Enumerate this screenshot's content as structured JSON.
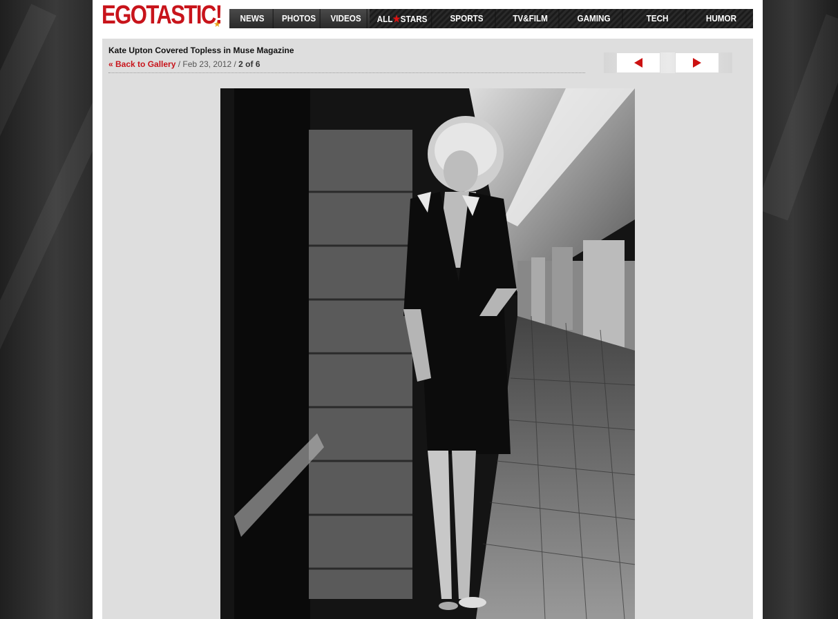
{
  "site": {
    "logo": "EGOTASTIC!"
  },
  "nav": {
    "items": [
      {
        "label": "NEWS"
      },
      {
        "label": "PHOTOS"
      },
      {
        "label": "VIDEOS"
      },
      {
        "label": "ALL",
        "label2": "STARS"
      },
      {
        "label": "SPORTS"
      },
      {
        "label": "TV&FILM"
      },
      {
        "label": "GAMING"
      },
      {
        "label": "TECH"
      },
      {
        "label": "HUMOR"
      }
    ]
  },
  "gallery": {
    "title": "Kate Upton Covered Topless in Muse Magazine",
    "back_link": "« Back to Gallery",
    "separator": " / ",
    "date": "Feb 23, 2012",
    "position": "2 of 6"
  },
  "colors": {
    "brand_red": "#c8141b",
    "arrow_red": "#cc1111"
  },
  "icons": {
    "prev": "left-triangle-arrow",
    "next": "right-triangle-arrow"
  }
}
